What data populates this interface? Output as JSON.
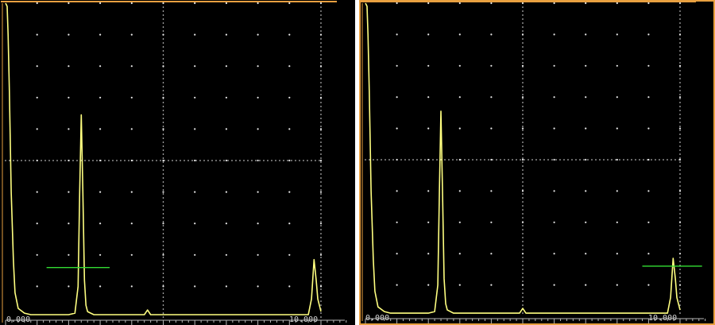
{
  "colors": {
    "background": "#000000",
    "trace": "#ffff80",
    "gate": "#33dd33",
    "grid_dot": "#e8e8e8",
    "scale": "#b8b8b8",
    "frame": "#e8a040",
    "divider": "#ffffff"
  },
  "chart_data": [
    {
      "type": "line",
      "title": "",
      "xlabel": "",
      "ylabel": "",
      "xlim": [
        0,
        10
      ],
      "ylim": [
        0,
        100
      ],
      "grid": true,
      "x_tick_labels": [
        "0.000",
        "10.000"
      ],
      "series": [
        {
          "x": [
            0.0,
            0.05,
            0.08,
            0.12,
            0.18,
            0.25,
            0.3,
            0.4,
            0.6,
            0.8,
            1.2,
            1.6,
            2.0,
            2.2,
            2.3,
            2.35,
            2.4,
            2.45,
            2.5,
            2.55,
            2.6,
            2.7,
            2.8,
            3.0,
            3.5,
            4.0,
            4.4,
            4.5,
            4.6,
            5.0,
            6.0,
            7.0,
            8.0,
            9.0,
            9.6,
            9.7,
            9.78,
            9.85,
            9.9,
            10.0
          ],
          "y": [
            100,
            99,
            90,
            72,
            40,
            18,
            8,
            3,
            1.5,
            1,
            1,
            1,
            1,
            1.5,
            10,
            40,
            64.5,
            40,
            12,
            4,
            2,
            1.5,
            1,
            1,
            1,
            1,
            1,
            2.5,
            1,
            1,
            1,
            1,
            1,
            1,
            1,
            6,
            18.5,
            12,
            6,
            2
          ]
        }
      ],
      "gate": {
        "x_start": 1.3,
        "x_end": 3.3,
        "level": 16
      }
    },
    {
      "type": "line",
      "title": "",
      "xlabel": "",
      "ylabel": "",
      "xlim": [
        0,
        10
      ],
      "ylim": [
        0,
        100
      ],
      "grid": true,
      "x_tick_labels": [
        "0.000",
        "10.000"
      ],
      "series": [
        {
          "x": [
            0.0,
            0.05,
            0.08,
            0.12,
            0.18,
            0.25,
            0.3,
            0.4,
            0.6,
            0.8,
            1.2,
            1.6,
            2.0,
            2.2,
            2.3,
            2.35,
            2.4,
            2.45,
            2.5,
            2.55,
            2.6,
            2.7,
            2.8,
            3.0,
            3.5,
            4.0,
            4.9,
            5.0,
            5.1,
            6.0,
            7.0,
            8.0,
            9.0,
            9.6,
            9.7,
            9.78,
            9.85,
            9.9,
            10.0
          ],
          "y": [
            100,
            99,
            90,
            72,
            40,
            18,
            8,
            3,
            1.5,
            1,
            1,
            1,
            1,
            1.5,
            10,
            40,
            65.5,
            40,
            12,
            4,
            2,
            1.5,
            1,
            1,
            1,
            1,
            1,
            2.5,
            1,
            1,
            1,
            1,
            1,
            1,
            6,
            18.5,
            12,
            6,
            2
          ]
        }
      ],
      "gate": {
        "x_start": 8.8,
        "x_end": 10.7,
        "level": 16
      }
    }
  ]
}
